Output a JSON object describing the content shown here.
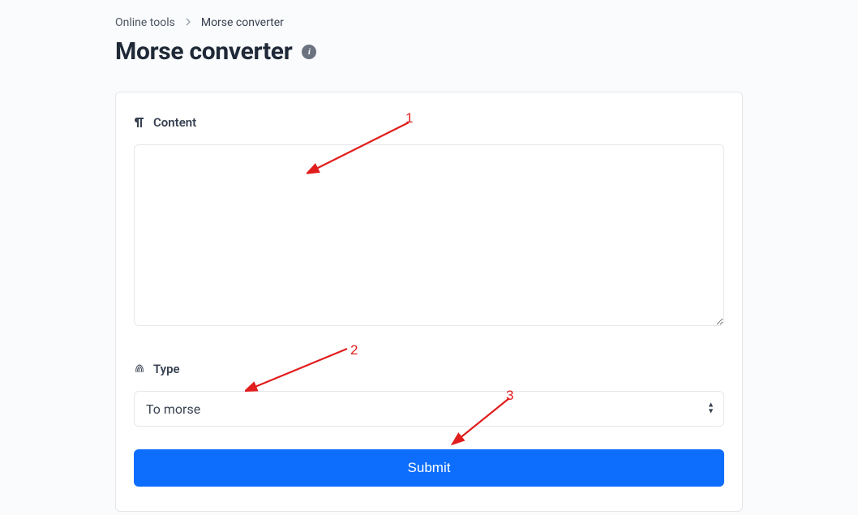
{
  "breadcrumb": {
    "root": "Online tools",
    "current": "Morse converter"
  },
  "page": {
    "title": "Morse converter"
  },
  "form": {
    "content_label": "Content",
    "content_value": "",
    "type_label": "Type",
    "type_selected": "To morse",
    "submit_label": "Submit"
  },
  "annotations": {
    "a1": "1",
    "a2": "2",
    "a3": "3"
  }
}
